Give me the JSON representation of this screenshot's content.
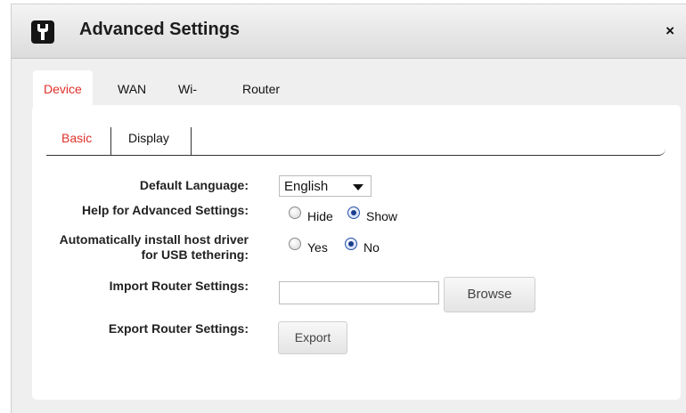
{
  "dialog": {
    "title": "Advanced Settings",
    "close_label": "×",
    "icon": "wrench-icon"
  },
  "main_tabs": [
    {
      "label": "Device",
      "active": true
    },
    {
      "label": "WAN",
      "active": false
    },
    {
      "label": "Wi-Fi",
      "active": false
    },
    {
      "label": "Router",
      "active": false
    }
  ],
  "sub_tabs": [
    {
      "label": "Basic",
      "active": true
    },
    {
      "label": "Display",
      "active": false
    }
  ],
  "form": {
    "default_language": {
      "label": "Default Language:",
      "value": "English"
    },
    "help_advanced": {
      "label": "Help for Advanced Settings:",
      "options": [
        "Hide",
        "Show"
      ],
      "selected": "Show"
    },
    "usb_driver": {
      "label_line1": "Automatically install host driver",
      "label_line2": "for USB tethering:",
      "options": [
        "Yes",
        "No"
      ],
      "selected": "No"
    },
    "import_settings": {
      "label": "Import Router Settings:",
      "value": "",
      "button": "Browse"
    },
    "export_settings": {
      "label": "Export Router Settings:",
      "button": "Export"
    }
  },
  "colors": {
    "accent": "#e0302a",
    "radio_selected": "#1b3d8f"
  }
}
